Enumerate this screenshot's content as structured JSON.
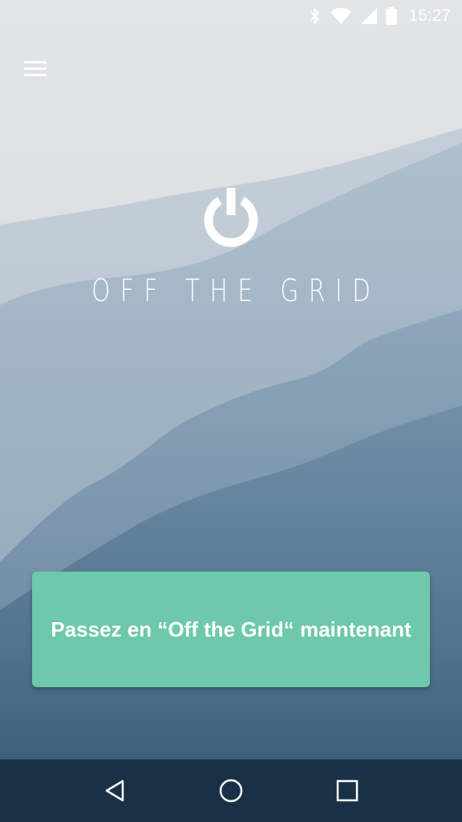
{
  "status_bar": {
    "time": "15:27",
    "icons": [
      "bluetooth-icon",
      "wifi-icon",
      "signal-icon",
      "battery-icon"
    ]
  },
  "header": {
    "menu_icon": "hamburger-menu-icon"
  },
  "app": {
    "logo_icon": "power-icon",
    "title": "OFF THE GRID"
  },
  "cta": {
    "label": "Passez en “Off the Grid“ maintenant"
  },
  "nav": {
    "icons": [
      "back-icon",
      "home-icon",
      "recents-icon"
    ]
  },
  "colors": {
    "accent": "#6ec8ab",
    "nav_bar": "#1a3046",
    "text": "#ffffff"
  }
}
